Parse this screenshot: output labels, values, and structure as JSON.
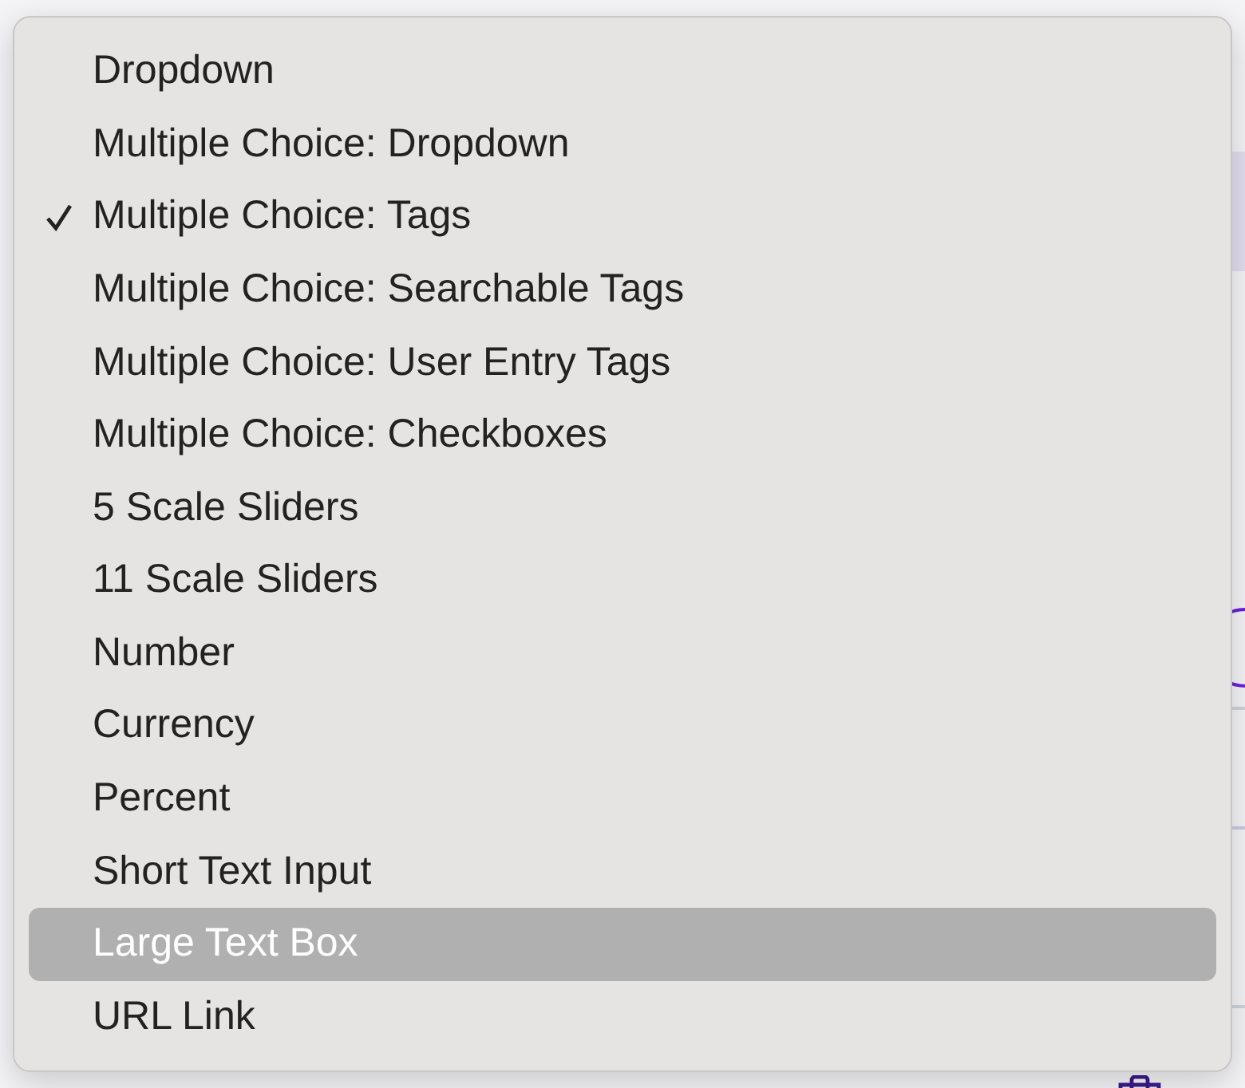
{
  "menu": {
    "items": [
      {
        "label": "Dropdown",
        "checked": false,
        "selected": false
      },
      {
        "label": "Multiple Choice: Dropdown",
        "checked": false,
        "selected": false
      },
      {
        "label": "Multiple Choice: Tags",
        "checked": true,
        "selected": false
      },
      {
        "label": "Multiple Choice: Searchable Tags",
        "checked": false,
        "selected": false
      },
      {
        "label": "Multiple Choice: User Entry Tags",
        "checked": false,
        "selected": false
      },
      {
        "label": "Multiple Choice: Checkboxes",
        "checked": false,
        "selected": false
      },
      {
        "label": "5 Scale Sliders",
        "checked": false,
        "selected": false
      },
      {
        "label": "11 Scale Sliders",
        "checked": false,
        "selected": false
      },
      {
        "label": "Number",
        "checked": false,
        "selected": false
      },
      {
        "label": "Currency",
        "checked": false,
        "selected": false
      },
      {
        "label": "Percent",
        "checked": false,
        "selected": false
      },
      {
        "label": "Short Text Input",
        "checked": false,
        "selected": false
      },
      {
        "label": "Large Text Box",
        "checked": false,
        "selected": true
      },
      {
        "label": "URL Link",
        "checked": false,
        "selected": false
      }
    ]
  }
}
